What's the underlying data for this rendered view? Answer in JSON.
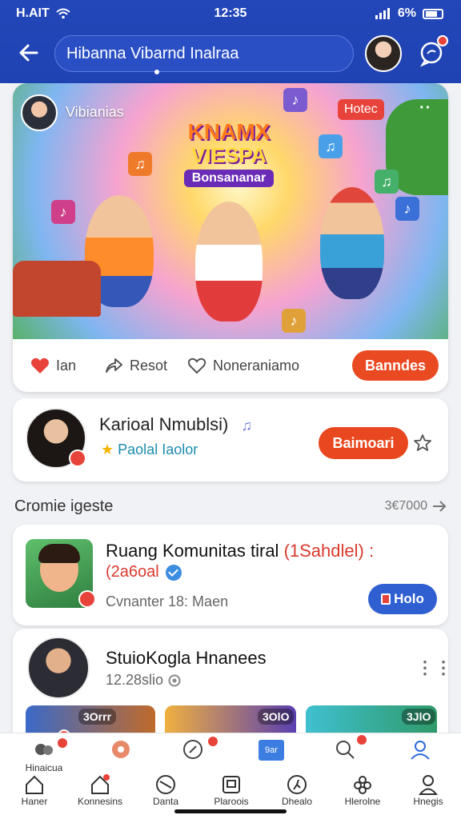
{
  "status_bar": {
    "carrier": "H.AIT",
    "time": "12:35",
    "battery": "6%"
  },
  "header": {
    "search_text": "Hibanna Vibarnd Inalraa",
    "back_icon": "arrow-left-icon",
    "message_icon": "chat-bubble-icon"
  },
  "banner": {
    "owner_name": "Vibianias",
    "tag": "Hotec",
    "logo_line1": "KNAMX",
    "logo_line2": "VIESPA",
    "logo_line3": "Bonsananar"
  },
  "actions": {
    "like": "Ian",
    "reset": "Resot",
    "comment": "Noneraniamo",
    "primary": "Banndes"
  },
  "creator": {
    "name": "Karioal Nmublsi)",
    "subtitle": "Paolal Iaolor",
    "button": "Baimoari"
  },
  "section": {
    "title": "Cromie igeste",
    "count": "3€7000"
  },
  "group": {
    "title_prefix": "Ruang Komunitas tiral ",
    "title_highlight": "(1Sahdlel) :",
    "meta": "(2a6oal",
    "subtitle": "Cvnanter 18: Maen",
    "button": "Holo"
  },
  "studio": {
    "name": "StuioKogla Hnanees",
    "subtitle": "12.28slio",
    "thumbs": [
      "3Orrr",
      "3OlO",
      "3JlO"
    ]
  },
  "bottom_nav": {
    "top": [
      "Hinaicua",
      "",
      "",
      "9ar",
      "",
      ""
    ],
    "bottom": [
      "Haner",
      "Konnesins",
      "Danta",
      "Plaroois",
      "Dhealo",
      "Hlerolne",
      "Hnegis"
    ]
  },
  "colors": {
    "header_blue": "#2346b8",
    "accent_orange": "#ea4a22",
    "accent_blue": "#2f5fd1"
  }
}
